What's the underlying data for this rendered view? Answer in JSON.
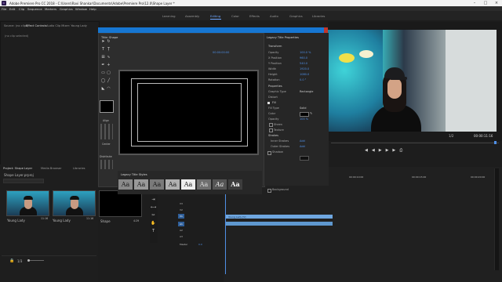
{
  "titlebar": {
    "title": "Adobe Premiere Pro CC 2018 - C:\\Users\\Ravi Shankar\\Documents\\Adobe\\Premiere Pro\\12.0\\Shape Layer *"
  },
  "menu": [
    "File",
    "Edit",
    "Clip",
    "Sequence",
    "Markers",
    "Graphics",
    "Window",
    "Help"
  ],
  "workspaces": [
    "Learning",
    "Assembly",
    "Editing",
    "Color",
    "Effects",
    "Audio",
    "Graphics",
    "Libraries"
  ],
  "active_workspace": "Editing",
  "source_panel": {
    "tabs": [
      "Source: (no clips)",
      "Effect Controls",
      "Audio Clip Mixer: Young Lady"
    ],
    "message": "(no clip selected)"
  },
  "title_designer": {
    "tab": "Title: Shape",
    "timecode": "00:00:00:00",
    "side_labels": [
      "Align",
      "Center",
      "Distribute"
    ],
    "styles_tab": "Legacy Title Styles",
    "styles": [
      "Aa",
      "Aa",
      "Aa",
      "Aa",
      "Aa",
      "Aa",
      "Aa",
      "Aa"
    ]
  },
  "properties": {
    "tab": "Legacy Title Properties",
    "rows": [
      {
        "label": "Transform",
        "value": ""
      },
      {
        "label": "Opacity",
        "value": "100.0 %"
      },
      {
        "label": "X Position",
        "value": "960.0"
      },
      {
        "label": "Y Position",
        "value": "540.0"
      },
      {
        "label": "Width",
        "value": "1920.0"
      },
      {
        "label": "Height",
        "value": "1080.0"
      },
      {
        "label": "Rotation",
        "value": "0.0 °"
      },
      {
        "label": "Properties",
        "value": ""
      },
      {
        "label": "Graphic Type",
        "value": "Rectangle"
      },
      {
        "label": "Distort",
        "value": ""
      },
      {
        "label": "Fill",
        "value": ""
      },
      {
        "label": "Fill Type",
        "value": "Solid"
      },
      {
        "label": "Color",
        "value": ""
      },
      {
        "label": "Opacity",
        "value": "100 %"
      },
      {
        "label": "Sheen",
        "value": ""
      },
      {
        "label": "Texture",
        "value": ""
      },
      {
        "label": "Strokes",
        "value": ""
      },
      {
        "label": "Inner Strokes",
        "value": "Add"
      },
      {
        "label": "Outer Strokes",
        "value": "Add"
      },
      {
        "label": "Shadow",
        "value": ""
      },
      {
        "label": "Background",
        "value": ""
      }
    ]
  },
  "program": {
    "timecode": "00:00:11:16",
    "fit": "1/2"
  },
  "project": {
    "tabs": [
      "Project: Shape Layer",
      "Media Browser",
      "Libraries"
    ],
    "filename": "Shape Layer.prproj",
    "items": [
      {
        "name": "Young Lady",
        "duration": "11:16"
      },
      {
        "name": "Young Lady",
        "duration": "11:16"
      }
    ],
    "shape_item": {
      "name": "Shape",
      "duration": "4:29"
    },
    "zoom_label": "1/3"
  },
  "timeline": {
    "tracks": [
      "V3",
      "V2",
      "V1",
      "A1",
      "A2",
      "A3"
    ],
    "master_label": "Master",
    "master_value": "0.0",
    "clips": [
      "Young Lady [V]"
    ],
    "ruler": [
      "00:00:05:00",
      "00:00:10:00",
      "00:00:15:00",
      "00:00:20:00"
    ]
  }
}
